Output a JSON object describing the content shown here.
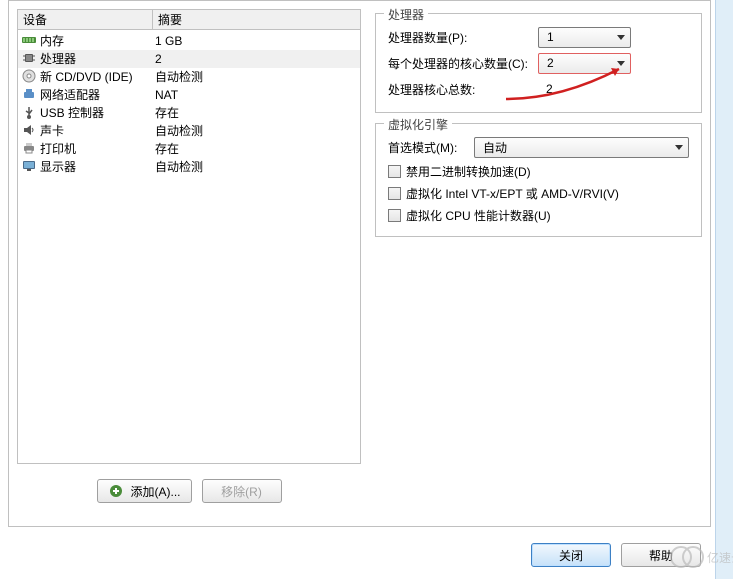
{
  "table": {
    "header_device": "设备",
    "header_summary": "摘要",
    "rows": [
      {
        "icon": "memory-icon",
        "name": "内存",
        "summary": "1 GB"
      },
      {
        "icon": "cpu-icon",
        "name": "处理器",
        "summary": "2"
      },
      {
        "icon": "cd-icon",
        "name": "新 CD/DVD (IDE)",
        "summary": "自动检测"
      },
      {
        "icon": "network-icon",
        "name": "网络适配器",
        "summary": "NAT"
      },
      {
        "icon": "usb-icon",
        "name": "USB 控制器",
        "summary": "存在"
      },
      {
        "icon": "sound-icon",
        "name": "声卡",
        "summary": "自动检测"
      },
      {
        "icon": "printer-icon",
        "name": "打印机",
        "summary": "存在"
      },
      {
        "icon": "display-icon",
        "name": "显示器",
        "summary": "自动检测"
      }
    ]
  },
  "buttons": {
    "add": "添加(A)...",
    "remove": "移除(R)",
    "close": "关闭",
    "help": "帮助"
  },
  "cpu_group": {
    "title": "处理器",
    "count_label": "处理器数量(P):",
    "count_value": "1",
    "cores_label": "每个处理器的核心数量(C):",
    "cores_value": "2",
    "total_label": "处理器核心总数:",
    "total_value": "2"
  },
  "virt_group": {
    "title": "虚拟化引擎",
    "mode_label": "首选模式(M):",
    "mode_value": "自动",
    "cb1": "禁用二进制转换加速(D)",
    "cb2": "虚拟化 Intel VT-x/EPT 或 AMD-V/RVI(V)",
    "cb3": "虚拟化 CPU 性能计数器(U)"
  }
}
